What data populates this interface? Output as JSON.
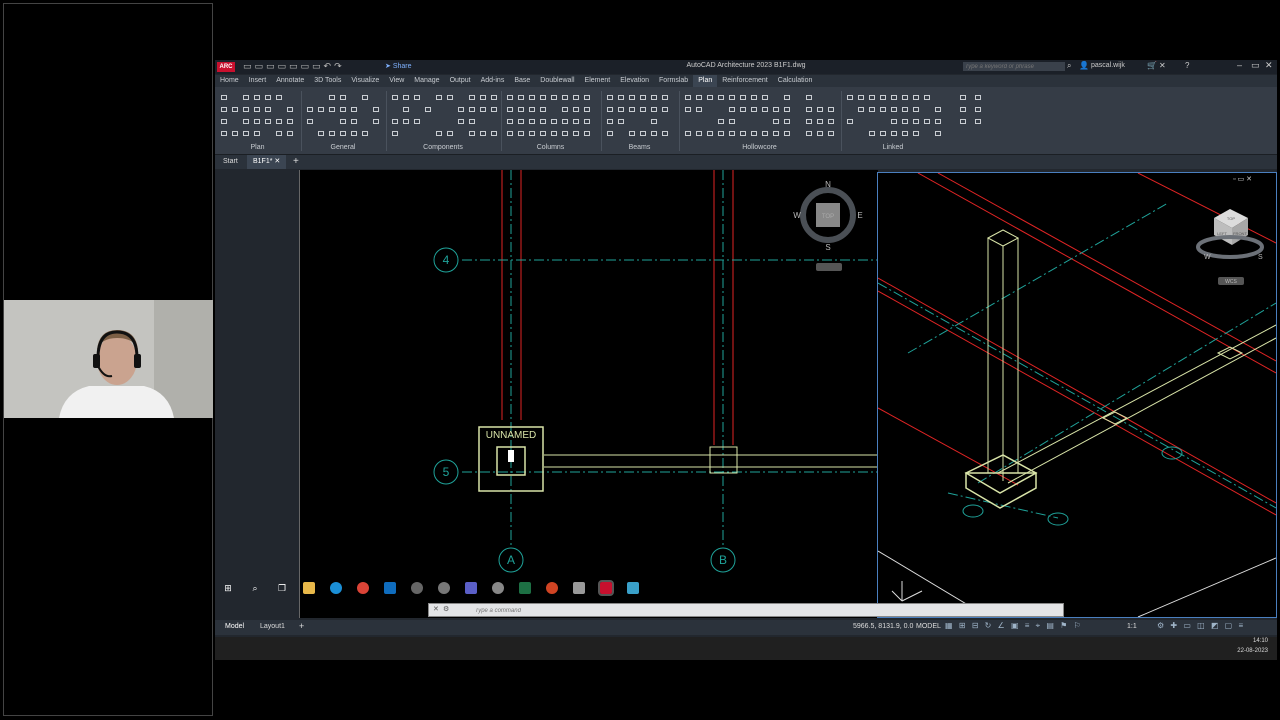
{
  "app": {
    "title": "AutoCAD Architecture 2023    B1F1.dwg",
    "badge": "ARC",
    "share": "Share",
    "search_placeholder": "Type a keyword or phrase",
    "user": "pascal.wijk"
  },
  "ribbon": {
    "tabs": [
      "Home",
      "Insert",
      "Annotate",
      "3D Tools",
      "Visualize",
      "View",
      "Manage",
      "Output",
      "Add-ins",
      "Base",
      "Doublewall",
      "Element",
      "Elevation",
      "Formslab",
      "Plan",
      "Reinforcement",
      "Calculation"
    ],
    "active_tab": "Plan",
    "panels": [
      "Plan",
      "General",
      "Components",
      "Columns",
      "Beams",
      "Hollowcore",
      "Linked"
    ]
  },
  "filetabs": {
    "start": "Start",
    "current": "B1F1*",
    "add": "+"
  },
  "drawing": {
    "grid_rows": [
      "4",
      "5"
    ],
    "grid_cols": [
      "A",
      "B"
    ],
    "column_tag": "UNNAMED",
    "compass": {
      "n": "N",
      "s": "S",
      "e": "E",
      "w": "W",
      "top": "TOP"
    }
  },
  "viewcube": {
    "top": "TOP",
    "left": "LEFT",
    "front": "FRONT",
    "wcs": "WCS",
    "w": "W",
    "s": "S"
  },
  "command": {
    "placeholder": "Type a command"
  },
  "status": {
    "tabs": [
      "Model",
      "Layout1"
    ],
    "add": "+",
    "coords": "5966.5, 8131.9, 0.0",
    "mode": "MODEL",
    "scale": "1:1"
  },
  "taskbar": {
    "time": "14:10",
    "date": "22-08-2023"
  },
  "colors": {
    "accent": "#e02424",
    "grid": "#1fa39a",
    "ribbon": "#353c46",
    "viewport_border": "#4a7fbf"
  }
}
